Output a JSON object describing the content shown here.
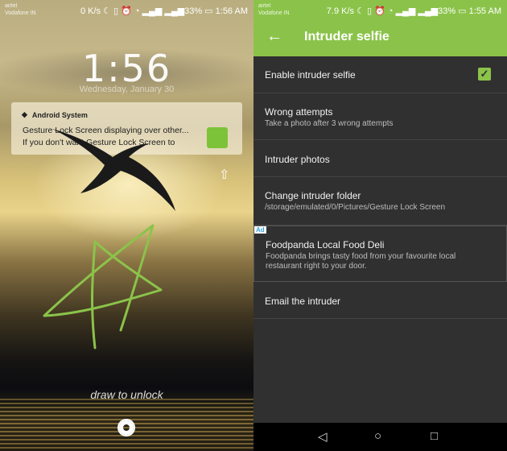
{
  "lock": {
    "status": {
      "carrier1": "airtel",
      "carrier2": "Vodafone IN",
      "speed": "0 K/s",
      "battery": "33%",
      "time": "1:56 AM"
    },
    "clock": "1:56",
    "date": "Wednesday, January 30",
    "notification": {
      "app": "Android System",
      "line1": "Gesture Lock Screen displaying over other...",
      "line2": "If you don't want Gesture Lock Screen to"
    },
    "hint": "draw to unlock",
    "gesture_color": "#8bc34a"
  },
  "settings": {
    "status": {
      "carrier1": "airtel",
      "carrier2": "Vodafone IN",
      "speed": "7.9 K/s",
      "battery": "33%",
      "time": "1:55 AM"
    },
    "title": "Intruder selfie",
    "accent": "#8bc34a",
    "items": [
      {
        "title": "Enable intruder selfie",
        "checked": true
      },
      {
        "title": "Wrong attempts",
        "subtitle": "Take a photo after 3 wrong attempts"
      },
      {
        "title": "Intruder photos"
      },
      {
        "title": "Change intruder folder",
        "subtitle": "/storage/emulated/0/Pictures/Gesture Lock Screen"
      },
      {
        "title": "Email the intruder"
      }
    ],
    "ad": {
      "tag": "Ad",
      "title": "Foodpanda Local Food Deli",
      "line1": "Foodpanda brings tasty food from your favourite local",
      "line2": "restaurant right to your door."
    }
  }
}
